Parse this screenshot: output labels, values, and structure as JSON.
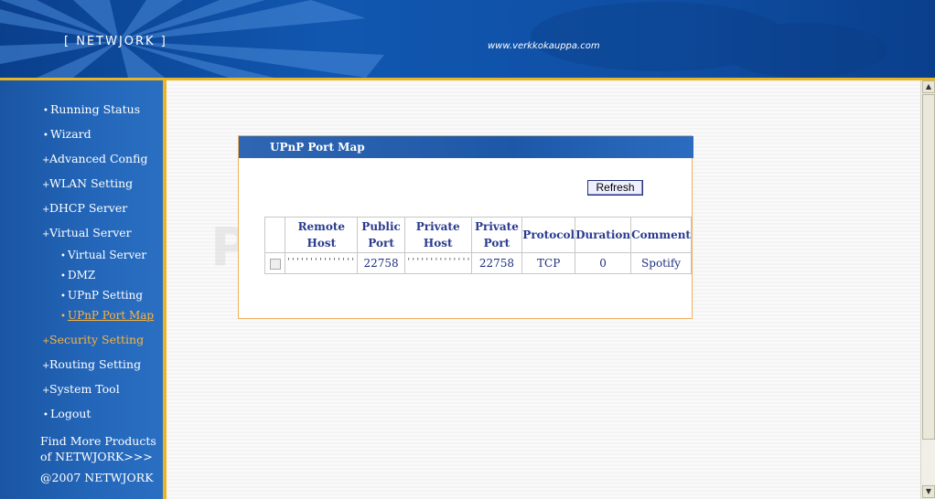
{
  "header": {
    "logo": "[ NETWJORK ]",
    "url": "www.verkkokauppa.com"
  },
  "sidebar": {
    "items": [
      {
        "label": "Running Status",
        "bullet": "•",
        "state": "normal"
      },
      {
        "label": "Wizard",
        "bullet": "•",
        "state": "normal"
      },
      {
        "label": "Advanced Config",
        "bullet": "+",
        "state": "normal"
      },
      {
        "label": "WLAN Setting",
        "bullet": "+",
        "state": "normal"
      },
      {
        "label": "DHCP Server",
        "bullet": "+",
        "state": "normal"
      },
      {
        "label": "Virtual Server",
        "bullet": "+",
        "state": "normal"
      },
      {
        "label": "Virtual Server",
        "bullet": "•",
        "state": "normal"
      },
      {
        "label": "DMZ",
        "bullet": "•",
        "state": "normal"
      },
      {
        "label": "UPnP Setting",
        "bullet": "•",
        "state": "normal"
      },
      {
        "label": "UPnP Port Map",
        "bullet": "•",
        "state": "current"
      },
      {
        "label": "Security Setting",
        "bullet": "+",
        "state": "active"
      },
      {
        "label": "Routing Setting",
        "bullet": "+",
        "state": "normal"
      },
      {
        "label": "System Tool",
        "bullet": "+",
        "state": "normal"
      },
      {
        "label": "Logout",
        "bullet": "•",
        "state": "normal"
      }
    ],
    "footer_line1": "Find More Products",
    "footer_line2": "of NETWJORK>>>",
    "copyright": "@2007 NETWJORK"
  },
  "watermark": "PcWinTech.com",
  "panel": {
    "title": "UPnP Port Map",
    "refresh_label": "Refresh",
    "columns": [
      "",
      "Remote Host",
      "Public Port",
      "Private Host",
      "Private Port",
      "Protocol",
      "Duration",
      "Comment"
    ],
    "rows": [
      {
        "remote_host": "'''''''''''''''''''1",
        "public_port": "22758",
        "private_host": "'''''''''''''''19",
        "private_port": "22758",
        "protocol": "TCP",
        "duration": "0",
        "comment": "Spotify"
      }
    ]
  },
  "colors": {
    "header_blue": "#1157b0",
    "sidebar_blue": "#2467ba",
    "accent_gold": "#e9b524",
    "active_orange": "#ffb43a",
    "table_text": "#2a3b8f"
  }
}
